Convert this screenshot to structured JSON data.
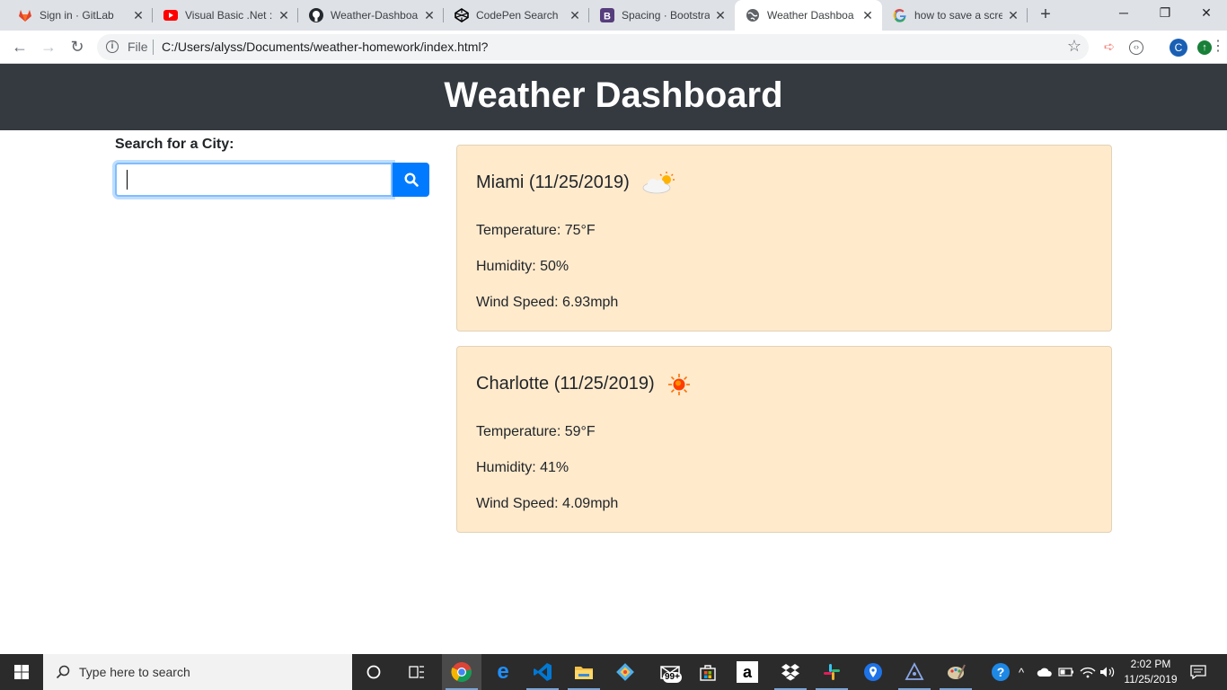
{
  "browser": {
    "tabs": [
      {
        "title": "Sign in · GitLab",
        "icon": "gitlab-icon"
      },
      {
        "title": "Visual Basic .Net :",
        "icon": "youtube-icon"
      },
      {
        "title": "Weather-Dashboa",
        "icon": "github-icon"
      },
      {
        "title": "CodePen Search",
        "icon": "codepen-icon"
      },
      {
        "title": "Spacing · Bootstra",
        "icon": "bootstrap-icon"
      },
      {
        "title": "Weather Dashboa",
        "icon": "globe-icon"
      },
      {
        "title": "how to save a scre",
        "icon": "google-icon"
      }
    ],
    "active_tab_index": 5,
    "address": {
      "scheme_label": "File",
      "url": "C:/Users/alyss/Documents/weather-homework/index.html?"
    },
    "profile_initial": "C"
  },
  "page": {
    "title": "Weather Dashboard",
    "search": {
      "label": "Search for a City:",
      "value": "",
      "placeholder": ""
    },
    "cards": [
      {
        "city_date": "Miami (11/25/2019)",
        "icon": "partly-cloudy-icon",
        "temperature": "Temperature: 75°F",
        "humidity": "Humidity: 50%",
        "wind": "Wind Speed: 6.93mph"
      },
      {
        "city_date": "Charlotte (11/25/2019)",
        "icon": "sun-icon",
        "temperature": "Temperature: 59°F",
        "humidity": "Humidity: 41%",
        "wind": "Wind Speed: 4.09mph"
      }
    ],
    "colors": {
      "header_bg": "#343a40",
      "card_bg": "#ffeacc",
      "button_bg": "#007bff"
    }
  },
  "taskbar": {
    "search_placeholder": "Type here to search",
    "mail_badge": "99+",
    "time": "2:02 PM",
    "date": "11/25/2019"
  }
}
